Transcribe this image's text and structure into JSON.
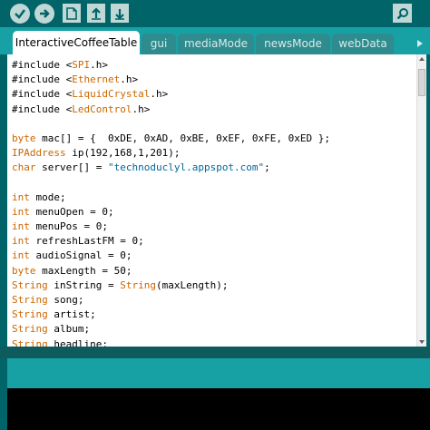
{
  "toolbar": {
    "verify_icon": "check-icon",
    "upload_icon": "arrow-right-icon",
    "new_icon": "file-icon",
    "open_icon": "arrow-up-icon",
    "save_icon": "arrow-down-icon",
    "serial_monitor_icon": "magnifier-icon"
  },
  "tabs": [
    {
      "label": "InteractiveCoffeeTable",
      "active": true
    },
    {
      "label": "gui",
      "active": false
    },
    {
      "label": "mediaMode",
      "active": false
    },
    {
      "label": "newsMode",
      "active": false
    },
    {
      "label": "webData",
      "active": false
    }
  ],
  "code_lines": [
    [
      {
        "t": "#include <"
      },
      {
        "t": "SPI",
        "c": "lib"
      },
      {
        "t": ".h>"
      }
    ],
    [
      {
        "t": "#include <"
      },
      {
        "t": "Ethernet",
        "c": "lib"
      },
      {
        "t": ".h>"
      }
    ],
    [
      {
        "t": "#include <"
      },
      {
        "t": "LiquidCrystal",
        "c": "lib"
      },
      {
        "t": ".h>"
      }
    ],
    [
      {
        "t": "#include <"
      },
      {
        "t": "LedControl",
        "c": "lib"
      },
      {
        "t": ".h>"
      }
    ],
    [],
    [
      {
        "t": "byte",
        "c": "ty"
      },
      {
        "t": " mac[] = {  0xDE, 0xAD, 0xBE, 0xEF, 0xFE, 0xED };"
      }
    ],
    [
      {
        "t": "IPAddress",
        "c": "lib"
      },
      {
        "t": " ip(192,168,1,201);"
      }
    ],
    [
      {
        "t": "char",
        "c": "ty"
      },
      {
        "t": " server[] = "
      },
      {
        "t": "\"technoduclyl.appspot.com\"",
        "c": "str"
      },
      {
        "t": ";"
      }
    ],
    [],
    [
      {
        "t": "int",
        "c": "ty"
      },
      {
        "t": " mode;"
      }
    ],
    [
      {
        "t": "int",
        "c": "ty"
      },
      {
        "t": " menuOpen = 0;"
      }
    ],
    [
      {
        "t": "int",
        "c": "ty"
      },
      {
        "t": " menuPos = 0;"
      }
    ],
    [
      {
        "t": "int",
        "c": "ty"
      },
      {
        "t": " refreshLastFM = 0;"
      }
    ],
    [
      {
        "t": "int",
        "c": "ty"
      },
      {
        "t": " audioSignal = 0;"
      }
    ],
    [
      {
        "t": "byte",
        "c": "ty"
      },
      {
        "t": " maxLength = 50;"
      }
    ],
    [
      {
        "t": "String",
        "c": "lib"
      },
      {
        "t": " inString = "
      },
      {
        "t": "String",
        "c": "lib"
      },
      {
        "t": "(maxLength);"
      }
    ],
    [
      {
        "t": "String",
        "c": "lib"
      },
      {
        "t": " song;"
      }
    ],
    [
      {
        "t": "String",
        "c": "lib"
      },
      {
        "t": " artist;"
      }
    ],
    [
      {
        "t": "String",
        "c": "lib"
      },
      {
        "t": " album;"
      }
    ],
    [
      {
        "t": "String",
        "c": "lib"
      },
      {
        "t": " headline;"
      }
    ]
  ],
  "colors": {
    "toolbar_bg": "#006468",
    "tabbar_bg": "#17a1a5",
    "tab_inactive": "#2e8b8e",
    "keyword": "#cc6600",
    "string": "#006699",
    "console_bg": "#000000"
  }
}
